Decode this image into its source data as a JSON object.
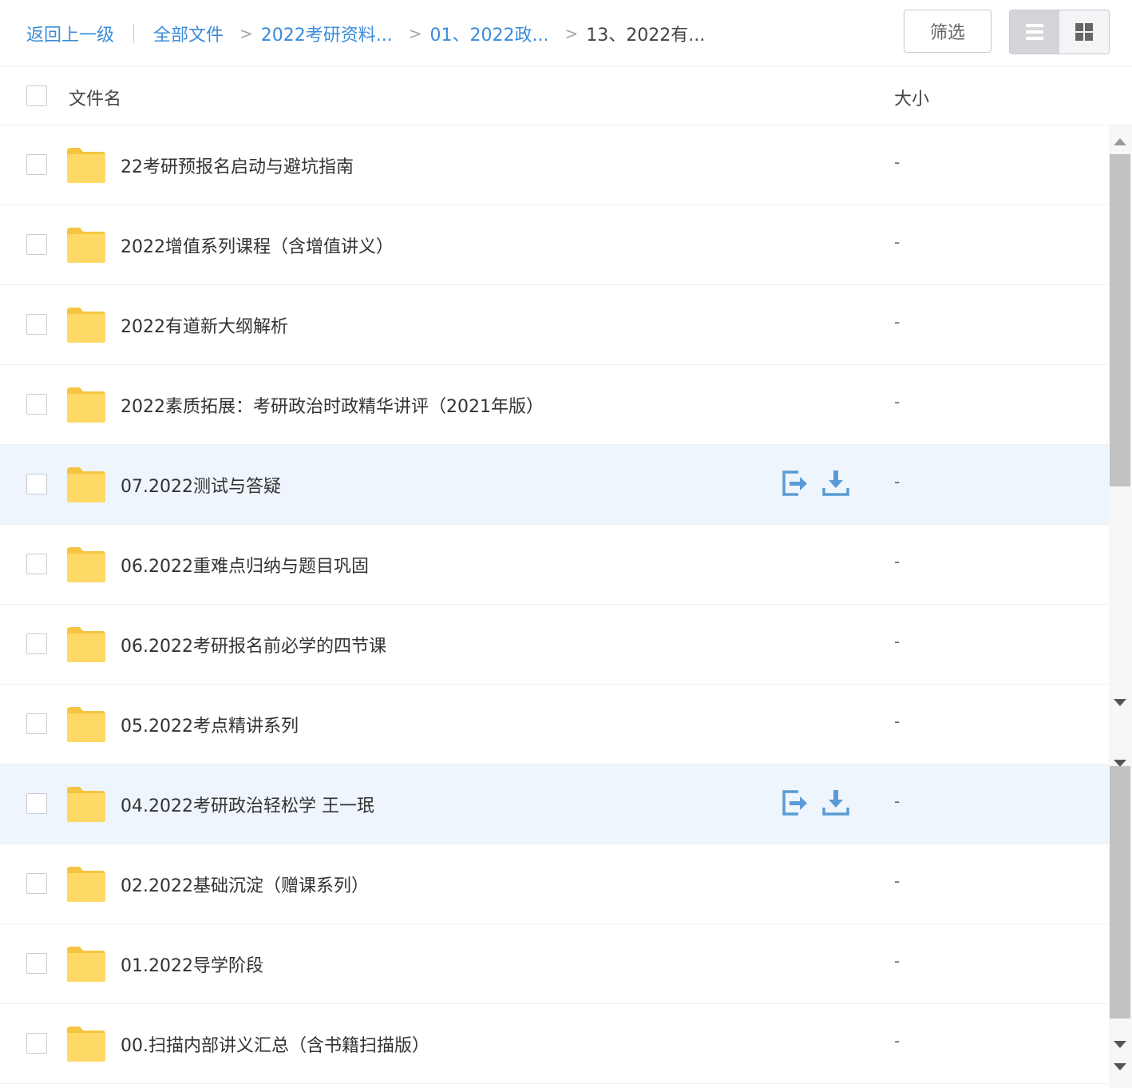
{
  "breadcrumb": {
    "back": "返回上一级",
    "all_files": "全部文件",
    "level1": "2022考研资料...",
    "level2": "01、2022政...",
    "current": "13、2022有..."
  },
  "toolbar": {
    "filter_label": "筛选",
    "view_mode": "list"
  },
  "table": {
    "col_name": "文件名",
    "col_size": "大小"
  },
  "files": [
    {
      "name": "22考研预报名启动与避坑指南",
      "size": "-",
      "type": "folder"
    },
    {
      "name": "2022增值系列课程（含增值讲义）",
      "size": "-",
      "type": "folder"
    },
    {
      "name": "2022有道新大纲解析",
      "size": "-",
      "type": "folder"
    },
    {
      "name": "2022素质拓展：考研政治时政精华讲评（2021年版）",
      "size": "-",
      "type": "folder"
    },
    {
      "name": "07.2022测试与答疑",
      "size": "-",
      "type": "folder",
      "hover": true
    },
    {
      "name": "06.2022重难点归纳与题目巩固",
      "size": "-",
      "type": "folder"
    },
    {
      "name": "06.2022考研报名前必学的四节课",
      "size": "-",
      "type": "folder"
    },
    {
      "name": "05.2022考点精讲系列",
      "size": "-",
      "type": "folder"
    },
    {
      "name": "04.2022考研政治轻松学  王一珉",
      "size": "-",
      "type": "folder",
      "hover": true
    },
    {
      "name": "02.2022基础沉淀（赠课系列）",
      "size": "-",
      "type": "folder"
    },
    {
      "name": "01.2022导学阶段",
      "size": "-",
      "type": "folder"
    },
    {
      "name": "00.扫描内部讲义汇总（含书籍扫描版）",
      "size": "-",
      "type": "folder"
    }
  ],
  "icons": {
    "folder": "folder-icon",
    "move": "move-icon",
    "download": "download-icon",
    "list_view": "list-view-icon",
    "grid_view": "grid-view-icon"
  },
  "colors": {
    "link": "#3b8cd8",
    "folder": "#ffd966",
    "folder_tab": "#f5c542",
    "hover_row": "#eef5fc",
    "action_icon": "#5b9bd5"
  }
}
